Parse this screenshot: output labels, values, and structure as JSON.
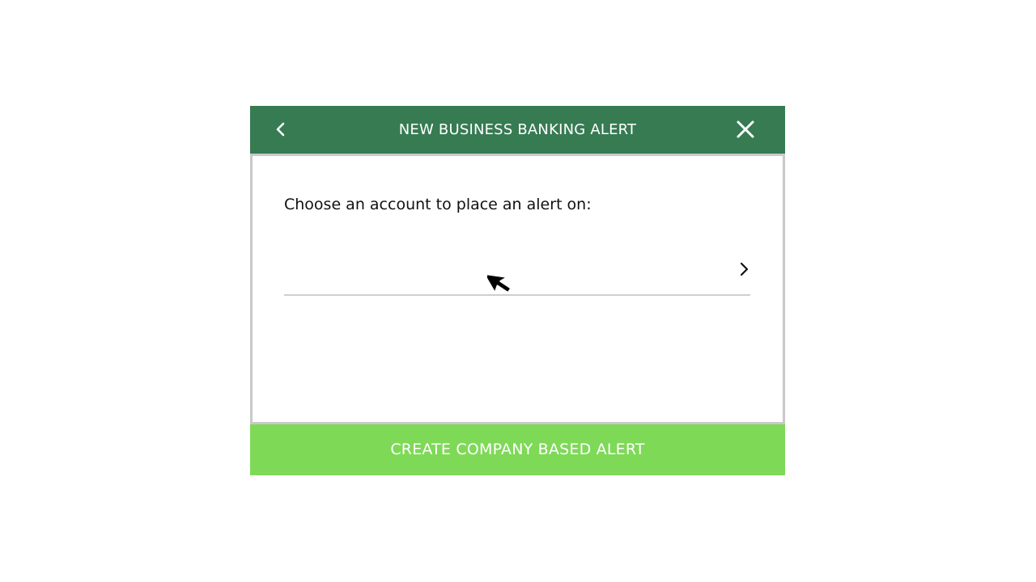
{
  "modal": {
    "title": "NEW BUSINESS BANKING ALERT",
    "back_icon": "chevron-left-icon",
    "close_icon": "close-icon",
    "prompt": "Choose an account to place an alert on:",
    "account_select": {
      "value": "",
      "icon": "chevron-right-icon"
    },
    "footer_button_label": "CREATE COMPANY BASED ALERT"
  },
  "colors": {
    "header_bg": "#367b52",
    "footer_bg": "#7ed957",
    "body_border": "#c9c9c9",
    "divider": "#cfcfcf"
  },
  "cursor_icon": "mouse-pointer-icon"
}
